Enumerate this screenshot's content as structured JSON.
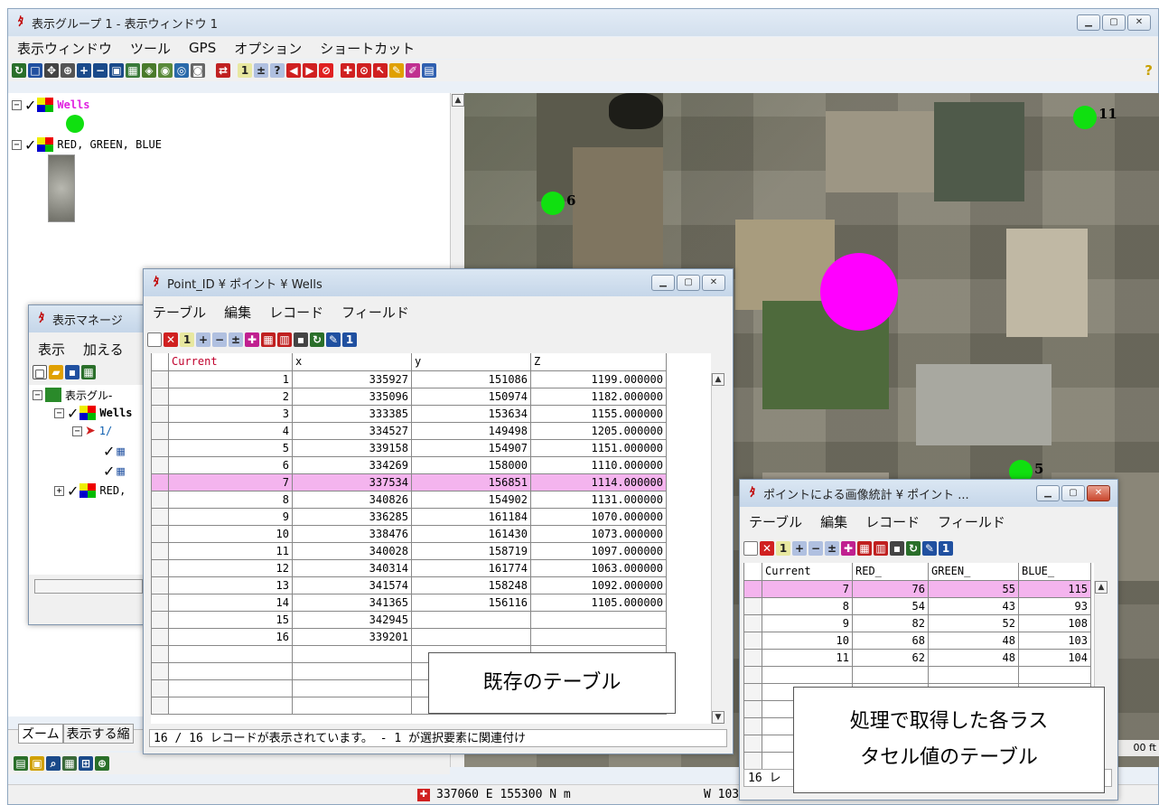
{
  "main": {
    "title": "表示グループ 1  - 表示ウィンドウ 1",
    "menu": [
      "表示ウィンドウ",
      "ツール",
      "GPS",
      "オプション",
      "ショートカット"
    ],
    "help_glyph": "?"
  },
  "layers": {
    "wells_name": "Wells",
    "rgb_name": "RED, GREEN, BLUE",
    "tree_collapse": "⊟"
  },
  "display_manager": {
    "title": "表示マネージ",
    "menu": [
      "表示",
      "加える"
    ],
    "tree": [
      "表示グル-",
      "Wells",
      "1/",
      "RED,"
    ],
    "tabs": [
      "ズーム",
      "表示する縮"
    ]
  },
  "map": {
    "wells": [
      {
        "label": "11"
      },
      {
        "label": "6"
      },
      {
        "label": "5"
      }
    ],
    "selected_well_color": "#ff00ff",
    "well_color": "#10e010",
    "scale_text": "00 ft"
  },
  "status": {
    "coords": "337060 E  155300 N m",
    "latlon": "W 103"
  },
  "table1": {
    "title": "Point_ID ¥ ポイント ¥ Wells",
    "menu": [
      "テーブル",
      "編集",
      "レコード",
      "フィールド"
    ],
    "columns": [
      "Current",
      "x",
      "y",
      "Z"
    ],
    "rows": [
      [
        "1",
        "335927",
        "151086",
        "1199.000000"
      ],
      [
        "2",
        "335096",
        "150974",
        "1182.000000"
      ],
      [
        "3",
        "333385",
        "153634",
        "1155.000000"
      ],
      [
        "4",
        "334527",
        "149498",
        "1205.000000"
      ],
      [
        "5",
        "339158",
        "154907",
        "1151.000000"
      ],
      [
        "6",
        "334269",
        "158000",
        "1110.000000"
      ],
      [
        "7",
        "337534",
        "156851",
        "1114.000000"
      ],
      [
        "8",
        "340826",
        "154902",
        "1131.000000"
      ],
      [
        "9",
        "336285",
        "161184",
        "1070.000000"
      ],
      [
        "10",
        "338476",
        "161430",
        "1073.000000"
      ],
      [
        "11",
        "340028",
        "158719",
        "1097.000000"
      ],
      [
        "12",
        "340314",
        "161774",
        "1063.000000"
      ],
      [
        "13",
        "341574",
        "158248",
        "1092.000000"
      ],
      [
        "14",
        "341365",
        "156116",
        "1105.000000"
      ],
      [
        "15",
        "342945",
        "",
        ""
      ],
      [
        "16",
        "339201",
        "",
        ""
      ]
    ],
    "highlight_row": 6,
    "status": "16 / 16 レコードが表示されています。 - 1 が選択要素に関連付け"
  },
  "table2": {
    "title": "ポイントによる画像統計 ¥ ポイント ...",
    "menu": [
      "テーブル",
      "編集",
      "レコード",
      "フィールド"
    ],
    "columns": [
      "Current",
      "RED_",
      "GREEN_",
      "BLUE_"
    ],
    "rows": [
      [
        "7",
        "76",
        "55",
        "115"
      ],
      [
        "8",
        "54",
        "43",
        "93"
      ],
      [
        "9",
        "82",
        "52",
        "108"
      ],
      [
        "10",
        "68",
        "48",
        "103"
      ],
      [
        "11",
        "62",
        "48",
        "104"
      ]
    ],
    "highlight_row": 0,
    "status": "16 レ"
  },
  "callouts": {
    "existing": "既存のテーブル",
    "line1": "処理で取得した各ラス",
    "line2": "タセル値のテーブル"
  }
}
